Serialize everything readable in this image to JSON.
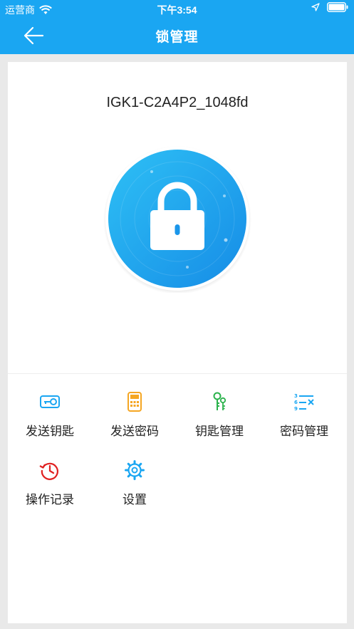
{
  "status_bar": {
    "carrier": "运营商",
    "time": "下午3:54"
  },
  "nav": {
    "title": "锁管理"
  },
  "device": {
    "name": "IGK1-C2A4P2_1048fd"
  },
  "menu": [
    {
      "label": "发送钥匙",
      "icon": "send-key-icon",
      "color": "#1aa6f2"
    },
    {
      "label": "发送密码",
      "icon": "calculator-icon",
      "color": "#f5a623"
    },
    {
      "label": "钥匙管理",
      "icon": "keys-icon",
      "color": "#2bb24c"
    },
    {
      "label": "密码管理",
      "icon": "password-list-icon",
      "color": "#1aa6f2"
    },
    {
      "label": "操作记录",
      "icon": "history-icon",
      "color": "#e02020"
    },
    {
      "label": "设置",
      "icon": "gear-icon",
      "color": "#1aa6f2"
    }
  ]
}
